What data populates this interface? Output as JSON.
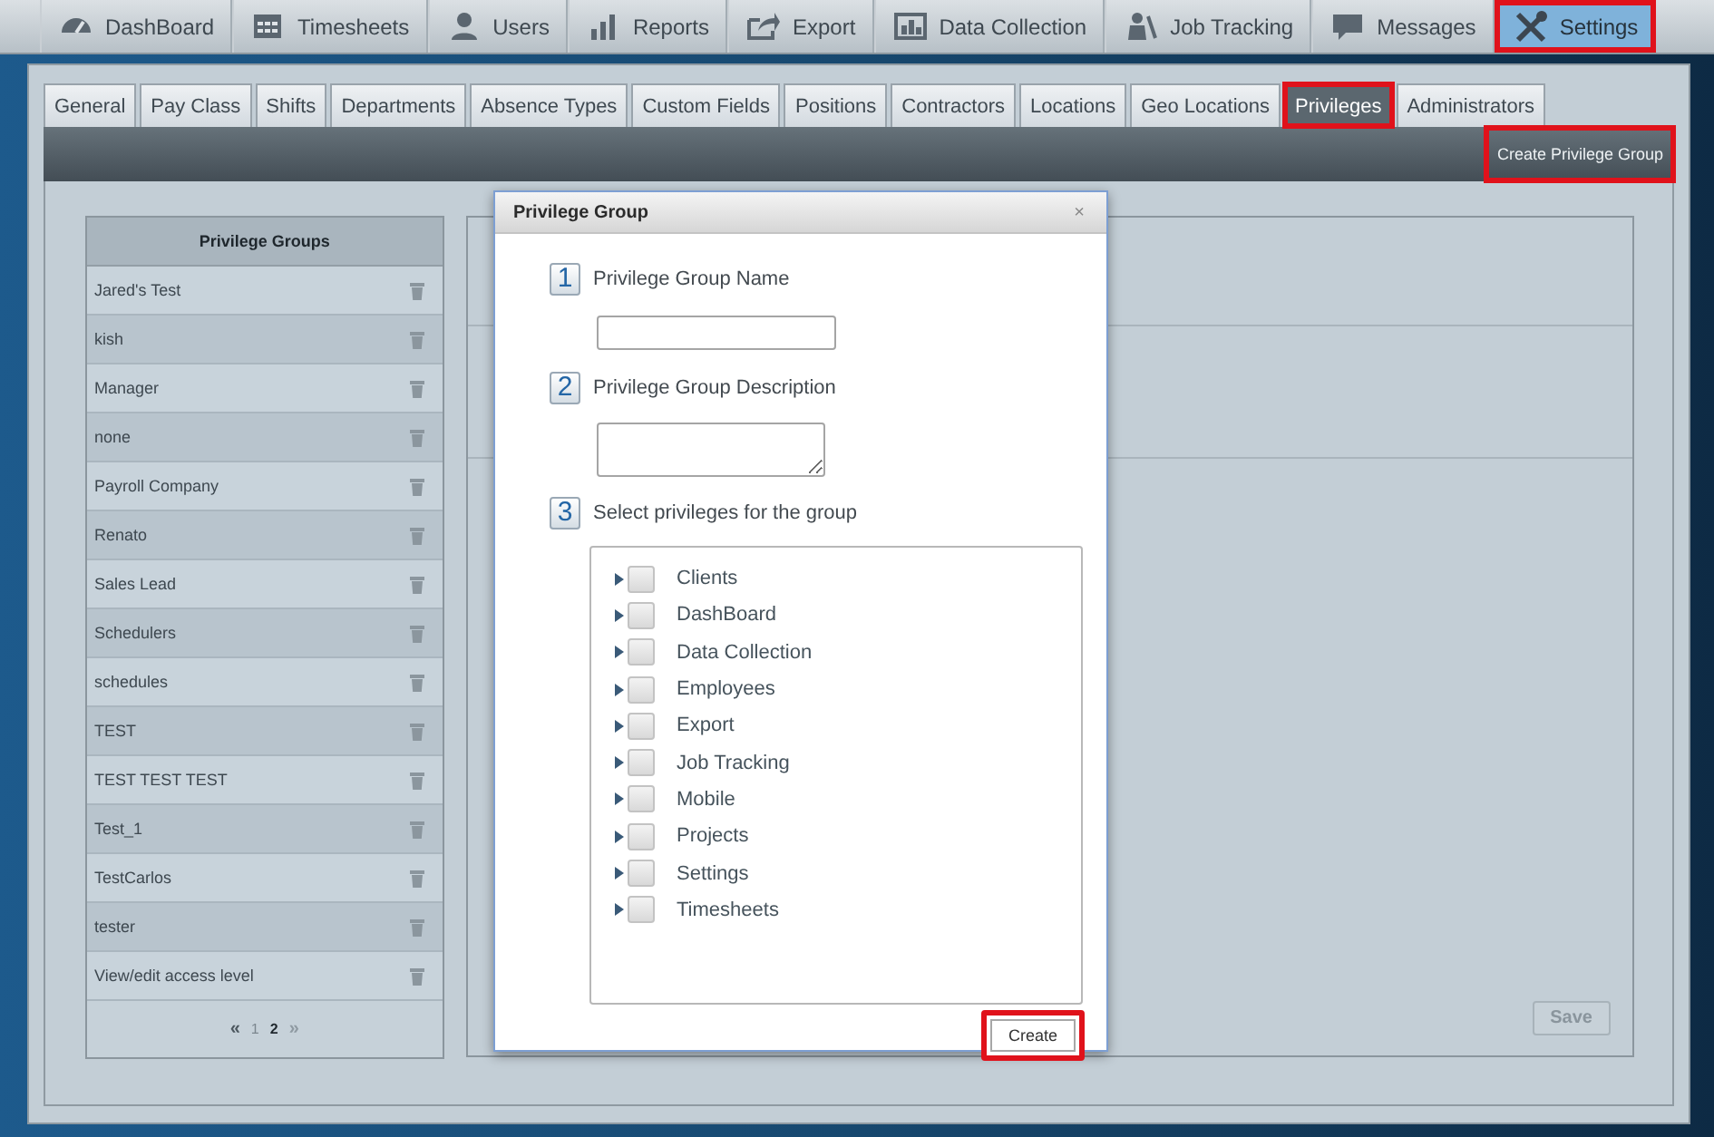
{
  "nav": [
    {
      "label": "DashBoard",
      "selected": false,
      "highlighted": false
    },
    {
      "label": "Timesheets",
      "selected": false,
      "highlighted": false
    },
    {
      "label": "Users",
      "selected": false,
      "highlighted": false
    },
    {
      "label": "Reports",
      "selected": false,
      "highlighted": false
    },
    {
      "label": "Export",
      "selected": false,
      "highlighted": false
    },
    {
      "label": "Data Collection",
      "selected": false,
      "highlighted": false
    },
    {
      "label": "Job Tracking",
      "selected": false,
      "highlighted": false
    },
    {
      "label": "Messages",
      "selected": false,
      "highlighted": false
    },
    {
      "label": "Settings",
      "selected": true,
      "highlighted": true
    }
  ],
  "tabs": [
    {
      "label": "General",
      "selected": false,
      "highlighted": false
    },
    {
      "label": "Pay Class",
      "selected": false,
      "highlighted": false
    },
    {
      "label": "Shifts",
      "selected": false,
      "highlighted": false
    },
    {
      "label": "Departments",
      "selected": false,
      "highlighted": false
    },
    {
      "label": "Absence Types",
      "selected": false,
      "highlighted": false
    },
    {
      "label": "Custom Fields",
      "selected": false,
      "highlighted": false
    },
    {
      "label": "Positions",
      "selected": false,
      "highlighted": false
    },
    {
      "label": "Contractors",
      "selected": false,
      "highlighted": false
    },
    {
      "label": "Locations",
      "selected": false,
      "highlighted": false
    },
    {
      "label": "Geo Locations",
      "selected": false,
      "highlighted": false
    },
    {
      "label": "Privileges",
      "selected": true,
      "highlighted": true
    },
    {
      "label": "Administrators",
      "selected": false,
      "highlighted": false
    }
  ],
  "toolbar": {
    "create_button": {
      "label": "Create Privilege Group",
      "highlighted": true
    }
  },
  "privilege_groups": {
    "title": "Privilege Groups",
    "items": [
      "Jared's Test",
      "kish",
      "Manager",
      "none",
      "Payroll Company",
      "Renato",
      "Sales Lead",
      "Schedulers",
      "schedules",
      "TEST",
      "TEST TEST TEST",
      "Test_1",
      "TestCarlos",
      "tester",
      "View/edit access level"
    ],
    "pagination": [
      {
        "label": "«",
        "kind": "prev"
      },
      {
        "label": "1",
        "kind": "page",
        "selected": false
      },
      {
        "label": "2",
        "kind": "page",
        "selected": true
      },
      {
        "label": "»",
        "kind": "next"
      }
    ]
  },
  "save_button": {
    "label": "Save",
    "disabled": true
  },
  "modal": {
    "title": "Privilege Group",
    "close": "×",
    "steps": [
      {
        "number": "1",
        "label": "Privilege Group Name",
        "kind": "input"
      },
      {
        "number": "2",
        "label": "Privilege Group Description",
        "kind": "textarea"
      },
      {
        "number": "3",
        "label": "Select privileges for the group",
        "kind": "tree"
      }
    ],
    "privileges": [
      {
        "label": "Clients",
        "checked": false,
        "expanded": false
      },
      {
        "label": "DashBoard",
        "checked": false,
        "expanded": false
      },
      {
        "label": "Data Collection",
        "checked": false,
        "expanded": false
      },
      {
        "label": "Employees",
        "checked": false,
        "expanded": false
      },
      {
        "label": "Export",
        "checked": false,
        "expanded": false
      },
      {
        "label": "Job Tracking",
        "checked": false,
        "expanded": false
      },
      {
        "label": "Mobile",
        "checked": false,
        "expanded": false
      },
      {
        "label": "Projects",
        "checked": false,
        "expanded": false
      },
      {
        "label": "Settings",
        "checked": false,
        "expanded": false
      },
      {
        "label": "Timesheets",
        "checked": false,
        "expanded": false
      }
    ],
    "create_button": {
      "label": "Create",
      "highlighted": true
    }
  }
}
